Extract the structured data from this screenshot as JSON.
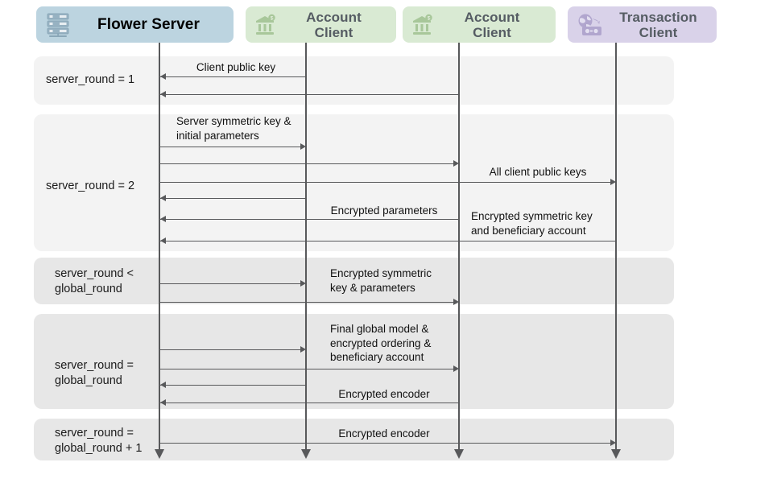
{
  "diagram": {
    "title": "Federated learning sequence diagram",
    "colors": {
      "server_box": "#bcd4e0",
      "client_box": "#d9ead3",
      "transaction_box": "#d9d2e9",
      "band_light": "#f3f3f3",
      "band_dark": "#e7e7e7",
      "line": "#58595b",
      "text": "#111111",
      "client_text": "#555c63"
    }
  },
  "actors": [
    {
      "id": "flower-server",
      "label": "Flower Server",
      "icon": "server-icon",
      "type": "server"
    },
    {
      "id": "account-client-1",
      "label": "Account\nClient",
      "icon": "bank-account-icon",
      "type": "client"
    },
    {
      "id": "account-client-2",
      "label": "Account\nClient",
      "icon": "bank-account-icon",
      "type": "client"
    },
    {
      "id": "transaction-client",
      "label": "Transaction\nClient",
      "icon": "money-transfer-icon",
      "type": "transaction"
    }
  ],
  "bands": [
    {
      "id": "band-round-1",
      "label": "server_round = 1"
    },
    {
      "id": "band-round-2",
      "label": "server_round = 2"
    },
    {
      "id": "band-round-lt-global",
      "label": "server_round <\nglobal_round"
    },
    {
      "id": "band-round-eq-global",
      "label": "server_round =\nglobal_round"
    },
    {
      "id": "band-round-eq-global-p1",
      "label": "server_round =\nglobal_round + 1"
    }
  ],
  "messages": [
    {
      "id": "m1",
      "from": "account-client-1",
      "to": "flower-server",
      "label": "Client public key"
    },
    {
      "id": "m2",
      "from": "account-client-2",
      "to": "flower-server",
      "label": ""
    },
    {
      "id": "m3",
      "from": "flower-server",
      "to": "account-client-1",
      "label": "Server symmetric key &\ninitial parameters"
    },
    {
      "id": "m4",
      "from": "flower-server",
      "to": "account-client-2",
      "label": ""
    },
    {
      "id": "m5",
      "from": "flower-server",
      "to": "transaction-client",
      "label": "All client public keys"
    },
    {
      "id": "m6",
      "from": "account-client-1",
      "to": "flower-server",
      "label": ""
    },
    {
      "id": "m7",
      "from": "account-client-2",
      "to": "flower-server",
      "label": "Encrypted parameters"
    },
    {
      "id": "m8",
      "from": "transaction-client",
      "to": "flower-server",
      "label": "Encrypted symmetric key\nand beneficiary account"
    },
    {
      "id": "m9",
      "from": "flower-server",
      "to": "account-client-1",
      "label": "Encrypted symmetric\nkey & parameters"
    },
    {
      "id": "m10",
      "from": "flower-server",
      "to": "account-client-2",
      "label": ""
    },
    {
      "id": "m11",
      "from": "flower-server",
      "to": "account-client-1",
      "label": "Final global model &\nencrypted ordering &\nbeneficiary account"
    },
    {
      "id": "m12",
      "from": "flower-server",
      "to": "account-client-2",
      "label": ""
    },
    {
      "id": "m13",
      "from": "account-client-1",
      "to": "flower-server",
      "label": ""
    },
    {
      "id": "m14",
      "from": "account-client-2",
      "to": "flower-server",
      "label": "Encrypted encoder"
    },
    {
      "id": "m15",
      "from": "flower-server",
      "to": "transaction-client",
      "label": "Encrypted encoder"
    }
  ]
}
